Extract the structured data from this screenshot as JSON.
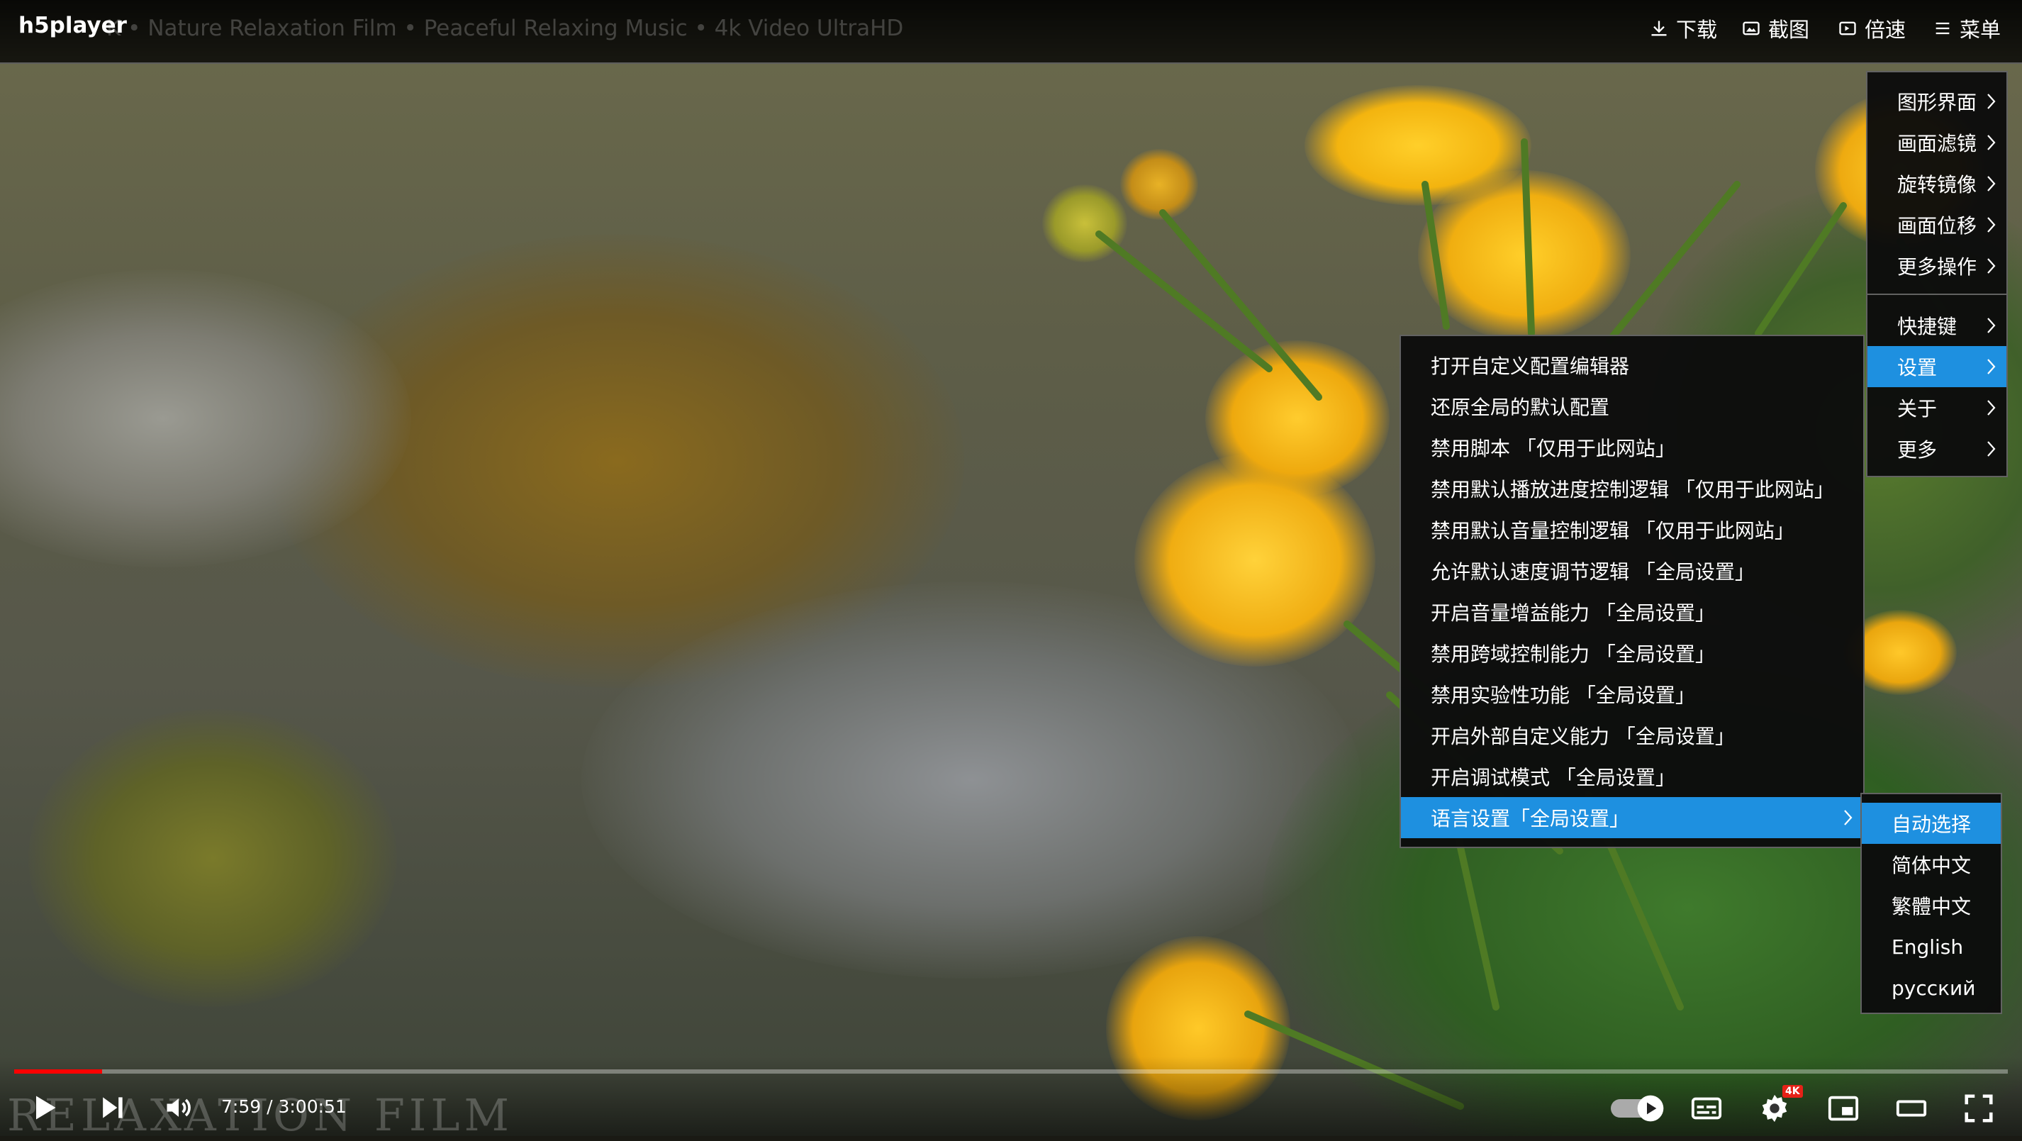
{
  "app": {
    "brand": "h5player",
    "video_title": "K • Nature Relaxation Film • Peaceful Relaxing Music • 4k Video UltraHD"
  },
  "toolbar": [
    {
      "label": "下载",
      "icon": "download-icon"
    },
    {
      "label": "截图",
      "icon": "screenshot-icon"
    },
    {
      "label": "倍速",
      "icon": "speed-icon"
    },
    {
      "label": "菜单",
      "icon": "menu-icon"
    }
  ],
  "main_menu": {
    "group1": [
      {
        "label": "图形界面"
      },
      {
        "label": "画面滤镜"
      },
      {
        "label": "旋转镜像"
      },
      {
        "label": "画面位移"
      },
      {
        "label": "更多操作"
      }
    ],
    "group2": [
      {
        "label": "快捷键"
      },
      {
        "label": "设置",
        "active": true
      },
      {
        "label": "关于"
      },
      {
        "label": "更多"
      }
    ]
  },
  "settings_menu": {
    "items": [
      {
        "label": "打开自定义配置编辑器"
      },
      {
        "label": "还原全局的默认配置"
      },
      {
        "label": "禁用脚本 「仅用于此网站」"
      },
      {
        "label": "禁用默认播放进度控制逻辑 「仅用于此网站」"
      },
      {
        "label": "禁用默认音量控制逻辑 「仅用于此网站」"
      },
      {
        "label": "允许默认速度调节逻辑 「全局设置」"
      },
      {
        "label": "开启音量增益能力 「全局设置」"
      },
      {
        "label": "禁用跨域控制能力 「全局设置」"
      },
      {
        "label": "禁用实验性功能 「全局设置」"
      },
      {
        "label": "开启外部自定义能力 「全局设置」"
      },
      {
        "label": "开启调试模式 「全局设置」"
      },
      {
        "label": "语言设置「全局设置」",
        "active": true,
        "submenu": true
      }
    ]
  },
  "language_menu": {
    "items": [
      {
        "label": "自动选择",
        "active": true
      },
      {
        "label": "简体中文"
      },
      {
        "label": "繁體中文"
      },
      {
        "label": "English"
      },
      {
        "label": "русский"
      }
    ]
  },
  "player": {
    "time": "7:59 / 3:00:51",
    "progress": 0.044,
    "badge": "4K",
    "watermark": "RELAXATION FILM",
    "icons": [
      "play-icon",
      "next-icon",
      "volume-icon",
      "autoplay-toggle-icon",
      "subtitles-icon",
      "settings-icon",
      "miniplayer-icon",
      "theater-icon",
      "fullscreen-icon"
    ]
  },
  "colors": {
    "accent": "#1e90e0",
    "progress": "#ff0000",
    "menu_bg": "#0c0c0c"
  }
}
